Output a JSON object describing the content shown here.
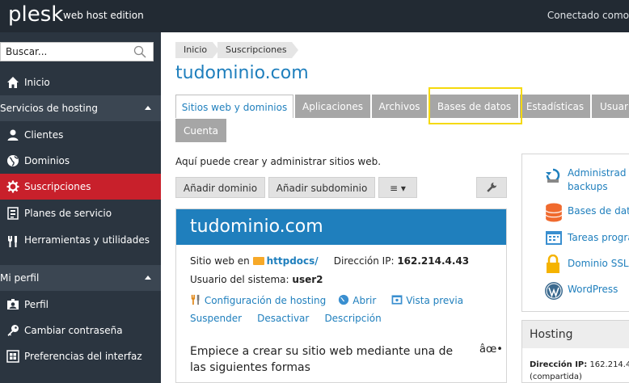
{
  "topbar": {
    "logo": "plesk",
    "edition": "web host edition",
    "connected": "Conectado como"
  },
  "sidebar": {
    "search_placeholder": "Buscar...",
    "items": [
      {
        "label": "Inicio",
        "icon": "home-icon"
      },
      {
        "label": "Servicios de hosting",
        "group": true
      },
      {
        "label": "Clientes",
        "icon": "user-icon"
      },
      {
        "label": "Dominios",
        "icon": "globe-icon"
      },
      {
        "label": "Suscripciones",
        "icon": "gear-icon",
        "active": true
      },
      {
        "label": "Planes de servicio",
        "icon": "plan-icon"
      },
      {
        "label": "Herramientas y utilidades",
        "icon": "tools-icon"
      },
      {
        "label": "Mi perfil",
        "group": true
      },
      {
        "label": "Perfil",
        "icon": "profile-icon"
      },
      {
        "label": "Cambiar contraseña",
        "icon": "key-icon"
      },
      {
        "label": "Preferencias del interfaz",
        "icon": "prefs-icon"
      }
    ]
  },
  "breadcrumb": [
    "Inicio",
    "Suscripciones"
  ],
  "page_title": "tudominio.com",
  "tabs": [
    "Sitios web y dominios",
    "Aplicaciones",
    "Archivos",
    "Bases de datos",
    "Estadísticas",
    "Usuar",
    "Cuenta"
  ],
  "intro": "Aquí puede crear y administrar sitios web.",
  "toolbar": {
    "add_domain": "Añadir dominio",
    "add_subdomain": "Añadir subdominio",
    "menu": "≡ ▾",
    "wrench": "wrench-icon"
  },
  "site_card": {
    "title": "tudominio.com",
    "website_in": "Sitio web en",
    "folder": "httpdocs/",
    "ip_label": "Dirección IP:",
    "ip": "162.214.4.43",
    "sysuser_label": "Usuario del sistema:",
    "sysuser": "user2",
    "hosting_config": "Configuración de hosting",
    "open": "Abrir",
    "preview": "Vista previa",
    "suspend": "Suspender",
    "deactivate": "Desactivar",
    "description": "Descripción",
    "start": "Empiece a crear su sitio web mediante una de las siguientes formas",
    "odd": "âœ•"
  },
  "right_panel": {
    "items": [
      "Administrad",
      "backups",
      "Bases de dato",
      "Tareas progra",
      "Dominio SSL",
      "WordPress"
    ]
  },
  "hosting_box": {
    "title": "Hosting",
    "ip_label": "Dirección IP:",
    "ip": "162.214.4",
    "shared": "(compartida)"
  },
  "colors": {
    "brand_blue": "#1f7fbd",
    "active_red": "#c8202b",
    "sidebar_bg": "#2b3540",
    "highlight": "#f5d90c"
  }
}
